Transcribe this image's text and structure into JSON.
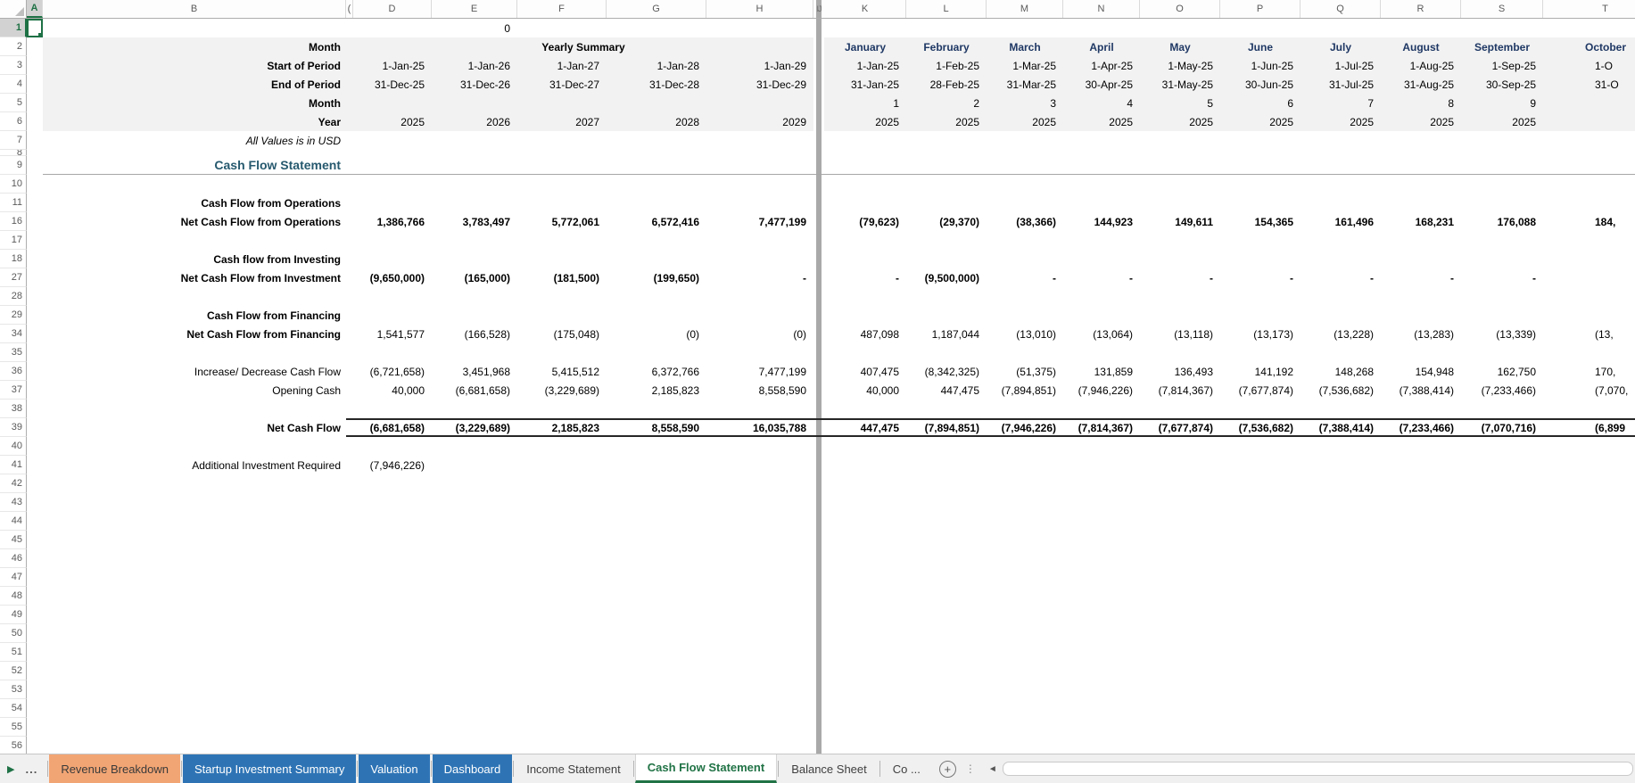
{
  "colors": {
    "selection_green": "#217346",
    "month_blue": "#1F3864",
    "heading_teal": "#26596E",
    "tab_orange": "#F2A574",
    "tab_blue": "#2E74B5",
    "band_gray": "#F2F2F2"
  },
  "sheet": {
    "col_letters_left": [
      "A",
      "B",
      "(",
      "D",
      "E",
      "F",
      "G",
      "H"
    ],
    "split_label": "IJ",
    "col_letters_right": [
      "K",
      "L",
      "M",
      "N",
      "O",
      "P",
      "Q",
      "R",
      "S",
      "T"
    ],
    "rows": [
      {
        "n": "1",
        "sel": "A",
        "cells": [
          [
            "E",
            "0",
            "n"
          ]
        ]
      },
      {
        "n": "2",
        "band": 1,
        "merge": "Yearly Summary",
        "cells": [
          [
            "B",
            "Month",
            "bl"
          ],
          [
            "K",
            "January",
            "mo"
          ],
          [
            "L",
            "February",
            "mo"
          ],
          [
            "M",
            "March",
            "mo"
          ],
          [
            "N",
            "April",
            "mo"
          ],
          [
            "O",
            "May",
            "mo"
          ],
          [
            "P",
            "June",
            "mo"
          ],
          [
            "Q",
            "July",
            "mo"
          ],
          [
            "R",
            "August",
            "mo"
          ],
          [
            "S",
            "September",
            "mo"
          ],
          [
            "T",
            "October",
            "mo"
          ]
        ]
      },
      {
        "n": "3",
        "band": 1,
        "cells": [
          [
            "B",
            "Start of Period",
            "bl"
          ],
          [
            "D",
            "1-Jan-25",
            "n"
          ],
          [
            "E",
            "1-Jan-26",
            "n"
          ],
          [
            "F",
            "1-Jan-27",
            "n"
          ],
          [
            "G",
            "1-Jan-28",
            "n"
          ],
          [
            "H",
            "1-Jan-29",
            "n"
          ],
          [
            "K",
            "1-Jan-25",
            "n"
          ],
          [
            "L",
            "1-Feb-25",
            "n"
          ],
          [
            "M",
            "1-Mar-25",
            "n"
          ],
          [
            "N",
            "1-Apr-25",
            "n"
          ],
          [
            "O",
            "1-May-25",
            "n"
          ],
          [
            "P",
            "1-Jun-25",
            "n"
          ],
          [
            "Q",
            "1-Jul-25",
            "n"
          ],
          [
            "R",
            "1-Aug-25",
            "n"
          ],
          [
            "S",
            "1-Sep-25",
            "n"
          ],
          [
            "T",
            "1-O",
            "nl"
          ]
        ]
      },
      {
        "n": "4",
        "band": 1,
        "cells": [
          [
            "B",
            "End of Period",
            "bl"
          ],
          [
            "D",
            "31-Dec-25",
            "n"
          ],
          [
            "E",
            "31-Dec-26",
            "n"
          ],
          [
            "F",
            "31-Dec-27",
            "n"
          ],
          [
            "G",
            "31-Dec-28",
            "n"
          ],
          [
            "H",
            "31-Dec-29",
            "n"
          ],
          [
            "K",
            "31-Jan-25",
            "n"
          ],
          [
            "L",
            "28-Feb-25",
            "n"
          ],
          [
            "M",
            "31-Mar-25",
            "n"
          ],
          [
            "N",
            "30-Apr-25",
            "n"
          ],
          [
            "O",
            "31-May-25",
            "n"
          ],
          [
            "P",
            "30-Jun-25",
            "n"
          ],
          [
            "Q",
            "31-Jul-25",
            "n"
          ],
          [
            "R",
            "31-Aug-25",
            "n"
          ],
          [
            "S",
            "30-Sep-25",
            "n"
          ],
          [
            "T",
            "31-O",
            "nl"
          ]
        ]
      },
      {
        "n": "5",
        "band": 1,
        "cells": [
          [
            "B",
            "Month",
            "bl"
          ],
          [
            "K",
            "1",
            "n"
          ],
          [
            "L",
            "2",
            "n"
          ],
          [
            "M",
            "3",
            "n"
          ],
          [
            "N",
            "4",
            "n"
          ],
          [
            "O",
            "5",
            "n"
          ],
          [
            "P",
            "6",
            "n"
          ],
          [
            "Q",
            "7",
            "n"
          ],
          [
            "R",
            "8",
            "n"
          ],
          [
            "S",
            "9",
            "n"
          ]
        ]
      },
      {
        "n": "6",
        "band": 1,
        "cells": [
          [
            "B",
            "Year",
            "bl"
          ],
          [
            "D",
            "2025",
            "n"
          ],
          [
            "E",
            "2026",
            "n"
          ],
          [
            "F",
            "2027",
            "n"
          ],
          [
            "G",
            "2028",
            "n"
          ],
          [
            "H",
            "2029",
            "n"
          ],
          [
            "K",
            "2025",
            "n"
          ],
          [
            "L",
            "2025",
            "n"
          ],
          [
            "M",
            "2025",
            "n"
          ],
          [
            "N",
            "2025",
            "n"
          ],
          [
            "O",
            "2025",
            "n"
          ],
          [
            "P",
            "2025",
            "n"
          ],
          [
            "Q",
            "2025",
            "n"
          ],
          [
            "R",
            "2025",
            "n"
          ],
          [
            "S",
            "2025",
            "n"
          ]
        ]
      },
      {
        "n": "7",
        "cells": [
          [
            "B",
            "All Values is in USD",
            "it"
          ]
        ]
      },
      {
        "n": "8",
        "tiny": 1,
        "cells": []
      },
      {
        "n": "9",
        "ul": 1,
        "cells": [
          [
            "B",
            "Cash Flow Statement",
            "ti"
          ]
        ]
      },
      {
        "n": "10",
        "cells": []
      },
      {
        "n": "11",
        "cells": [
          [
            "B",
            "Cash Flow from Operations",
            "bl"
          ]
        ]
      },
      {
        "n": "16",
        "cells": [
          [
            "B",
            "Net Cash Flow from Operations",
            "bl"
          ],
          [
            "D",
            "1,386,766",
            "nb"
          ],
          [
            "E",
            "3,783,497",
            "nb"
          ],
          [
            "F",
            "5,772,061",
            "nb"
          ],
          [
            "G",
            "6,572,416",
            "nb"
          ],
          [
            "H",
            "7,477,199",
            "nb"
          ],
          [
            "K",
            "(79,623)",
            "nb"
          ],
          [
            "L",
            "(29,370)",
            "nb"
          ],
          [
            "M",
            "(38,366)",
            "nb"
          ],
          [
            "N",
            "144,923",
            "nb"
          ],
          [
            "O",
            "149,611",
            "nb"
          ],
          [
            "P",
            "154,365",
            "nb"
          ],
          [
            "Q",
            "161,496",
            "nb"
          ],
          [
            "R",
            "168,231",
            "nb"
          ],
          [
            "S",
            "176,088",
            "nb"
          ],
          [
            "T",
            "184,",
            "nbl"
          ]
        ]
      },
      {
        "n": "17",
        "cells": []
      },
      {
        "n": "18",
        "cells": [
          [
            "B",
            "Cash flow from Investing",
            "bl"
          ]
        ]
      },
      {
        "n": "27",
        "cells": [
          [
            "B",
            "Net Cash Flow from Investment",
            "bl"
          ],
          [
            "D",
            "(9,650,000)",
            "nb"
          ],
          [
            "E",
            "(165,000)",
            "nb"
          ],
          [
            "F",
            "(181,500)",
            "nb"
          ],
          [
            "G",
            "(199,650)",
            "nb"
          ],
          [
            "H",
            "-",
            "nb"
          ],
          [
            "K",
            "-",
            "nb"
          ],
          [
            "L",
            "(9,500,000)",
            "nb"
          ],
          [
            "M",
            "-",
            "nb"
          ],
          [
            "N",
            "-",
            "nb"
          ],
          [
            "O",
            "-",
            "nb"
          ],
          [
            "P",
            "-",
            "nb"
          ],
          [
            "Q",
            "-",
            "nb"
          ],
          [
            "R",
            "-",
            "nb"
          ],
          [
            "S",
            "-",
            "nb"
          ]
        ]
      },
      {
        "n": "28",
        "cells": []
      },
      {
        "n": "29",
        "cells": [
          [
            "B",
            "Cash Flow from Financing",
            "bl"
          ]
        ]
      },
      {
        "n": "34",
        "cells": [
          [
            "B",
            "Net Cash Flow from Financing",
            "bl"
          ],
          [
            "D",
            "1,541,577",
            "n"
          ],
          [
            "E",
            "(166,528)",
            "n"
          ],
          [
            "F",
            "(175,048)",
            "n"
          ],
          [
            "G",
            "(0)",
            "n"
          ],
          [
            "H",
            "(0)",
            "n"
          ],
          [
            "K",
            "487,098",
            "n"
          ],
          [
            "L",
            "1,187,044",
            "n"
          ],
          [
            "M",
            "(13,010)",
            "n"
          ],
          [
            "N",
            "(13,064)",
            "n"
          ],
          [
            "O",
            "(13,118)",
            "n"
          ],
          [
            "P",
            "(13,173)",
            "n"
          ],
          [
            "Q",
            "(13,228)",
            "n"
          ],
          [
            "R",
            "(13,283)",
            "n"
          ],
          [
            "S",
            "(13,339)",
            "n"
          ],
          [
            "T",
            "(13,",
            "nl"
          ]
        ]
      },
      {
        "n": "35",
        "cells": []
      },
      {
        "n": "36",
        "cells": [
          [
            "B",
            "Increase/ Decrease Cash Flow",
            "rl"
          ],
          [
            "D",
            "(6,721,658)",
            "n"
          ],
          [
            "E",
            "3,451,968",
            "n"
          ],
          [
            "F",
            "5,415,512",
            "n"
          ],
          [
            "G",
            "6,372,766",
            "n"
          ],
          [
            "H",
            "7,477,199",
            "n"
          ],
          [
            "K",
            "407,475",
            "n"
          ],
          [
            "L",
            "(8,342,325)",
            "n"
          ],
          [
            "M",
            "(51,375)",
            "n"
          ],
          [
            "N",
            "131,859",
            "n"
          ],
          [
            "O",
            "136,493",
            "n"
          ],
          [
            "P",
            "141,192",
            "n"
          ],
          [
            "Q",
            "148,268",
            "n"
          ],
          [
            "R",
            "154,948",
            "n"
          ],
          [
            "S",
            "162,750",
            "n"
          ],
          [
            "T",
            "170,",
            "nl"
          ]
        ]
      },
      {
        "n": "37",
        "cells": [
          [
            "B",
            "Opening Cash",
            "rl"
          ],
          [
            "D",
            "40,000",
            "n"
          ],
          [
            "E",
            "(6,681,658)",
            "n"
          ],
          [
            "F",
            "(3,229,689)",
            "n"
          ],
          [
            "G",
            "2,185,823",
            "n"
          ],
          [
            "H",
            "8,558,590",
            "n"
          ],
          [
            "K",
            "40,000",
            "n"
          ],
          [
            "L",
            "447,475",
            "n"
          ],
          [
            "M",
            "(7,894,851)",
            "n"
          ],
          [
            "N",
            "(7,946,226)",
            "n"
          ],
          [
            "O",
            "(7,814,367)",
            "n"
          ],
          [
            "P",
            "(7,677,874)",
            "n"
          ],
          [
            "Q",
            "(7,536,682)",
            "n"
          ],
          [
            "R",
            "(7,388,414)",
            "n"
          ],
          [
            "S",
            "(7,233,466)",
            "n"
          ],
          [
            "T",
            "(7,070,",
            "nl"
          ]
        ]
      },
      {
        "n": "38",
        "cells": []
      },
      {
        "n": "39",
        "bd": 1,
        "cells": [
          [
            "B",
            "Net Cash Flow",
            "bl"
          ],
          [
            "D",
            "(6,681,658)",
            "nb"
          ],
          [
            "E",
            "(3,229,689)",
            "nb"
          ],
          [
            "F",
            "2,185,823",
            "nb"
          ],
          [
            "G",
            "8,558,590",
            "nb"
          ],
          [
            "H",
            "16,035,788",
            "nb"
          ],
          [
            "K",
            "447,475",
            "nb"
          ],
          [
            "L",
            "(7,894,851)",
            "nb"
          ],
          [
            "M",
            "(7,946,226)",
            "nb"
          ],
          [
            "N",
            "(7,814,367)",
            "nb"
          ],
          [
            "O",
            "(7,677,874)",
            "nb"
          ],
          [
            "P",
            "(7,536,682)",
            "nb"
          ],
          [
            "Q",
            "(7,388,414)",
            "nb"
          ],
          [
            "R",
            "(7,233,466)",
            "nb"
          ],
          [
            "S",
            "(7,070,716)",
            "nb"
          ],
          [
            "T",
            "(6,899",
            "nbl"
          ]
        ]
      },
      {
        "n": "40",
        "cells": []
      },
      {
        "n": "41",
        "cells": [
          [
            "B",
            "Additional Investment Required",
            "rl"
          ],
          [
            "D",
            "(7,946,226)",
            "n"
          ]
        ]
      },
      {
        "n": "42",
        "cells": []
      },
      {
        "n": "43",
        "cells": []
      },
      {
        "n": "44",
        "cells": []
      },
      {
        "n": "45",
        "cells": []
      },
      {
        "n": "46",
        "cells": []
      },
      {
        "n": "47",
        "cells": []
      },
      {
        "n": "48",
        "cells": []
      },
      {
        "n": "49",
        "cells": []
      },
      {
        "n": "50",
        "cells": []
      },
      {
        "n": "51",
        "cells": []
      },
      {
        "n": "52",
        "cells": []
      },
      {
        "n": "53",
        "cells": []
      },
      {
        "n": "54",
        "cells": []
      },
      {
        "n": "55",
        "cells": []
      },
      {
        "n": "56",
        "cells": []
      }
    ]
  },
  "tabbar": {
    "nav_next_icon": "▶",
    "more_label": "...",
    "tabs": [
      {
        "label": "Revenue Breakdown",
        "type": "orange"
      },
      {
        "label": "Startup Investment Summary",
        "type": "blue"
      },
      {
        "label": "Valuation",
        "type": "blue"
      },
      {
        "label": "Dashboard",
        "type": "blue"
      },
      {
        "label": "Income Statement",
        "type": "plain"
      },
      {
        "label": "Cash Flow Statement",
        "type": "active"
      },
      {
        "label": "Balance Sheet",
        "type": "plain"
      },
      {
        "label": "Co ...",
        "type": "plain"
      }
    ],
    "add_icon": "+",
    "menu_icon": "⋮",
    "scroll_left_icon": "◄"
  }
}
